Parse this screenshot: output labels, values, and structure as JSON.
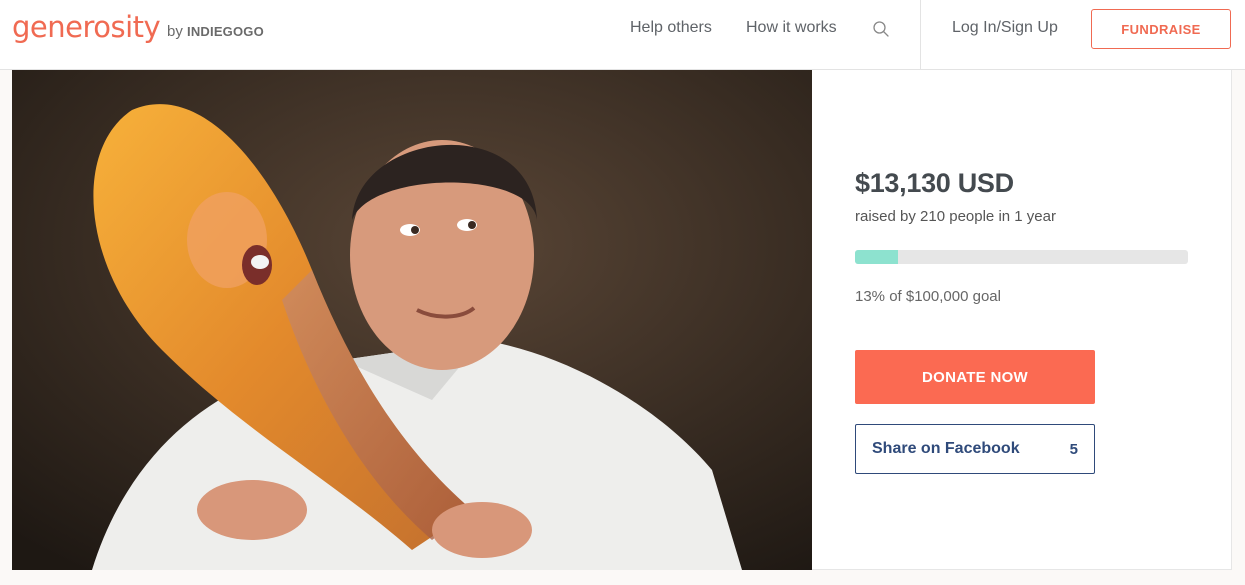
{
  "header": {
    "logo": "generosity",
    "by_text": "by",
    "by_brand": "INDIEGOGO",
    "nav": [
      "Help others",
      "How it works"
    ],
    "search_icon": "search-icon",
    "login_label": "Log In/Sign Up",
    "fundraise_label": "FUNDRAISE"
  },
  "campaign": {
    "amount": "$13,130 USD",
    "raised_by": "raised by 210 people in 1 year",
    "progress_fraction": 0.13,
    "goal_text": "13% of $100,000 goal",
    "donate_label": "DONATE NOW",
    "share_label": "Share on Facebook",
    "share_count": "5"
  },
  "colors": {
    "brand": "#f06a52",
    "donate": "#fb6a52",
    "progress": "#8de2cf",
    "facebook": "#2f4a7a"
  }
}
